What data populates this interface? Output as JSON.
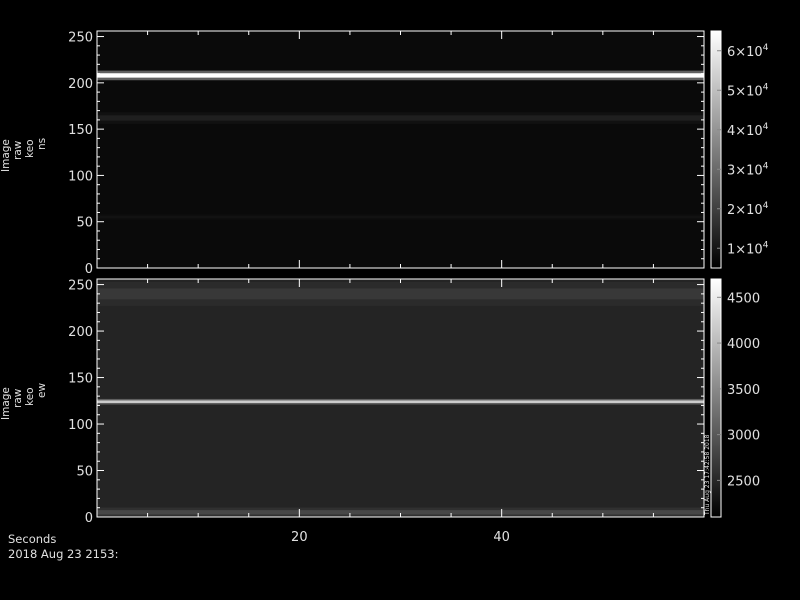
{
  "chart_data": [
    {
      "type": "heatmap",
      "ylabel_lines": [
        "Image",
        "raw",
        "keo",
        "ns"
      ],
      "ylim": [
        0,
        256
      ],
      "yticks": [
        0,
        50,
        100,
        150,
        200,
        250
      ],
      "ytick_labels": [
        "0",
        "50",
        "100",
        "150",
        "200",
        "250"
      ],
      "xlim": [
        0,
        60
      ],
      "colorbar": {
        "range": [
          5000,
          65000
        ],
        "ticks": [
          10000,
          20000,
          30000,
          40000,
          50000,
          60000
        ],
        "tick_labels": [
          {
            "mantissa": "1",
            "exp": "4"
          },
          {
            "mantissa": "2",
            "exp": "4"
          },
          {
            "mantissa": "3",
            "exp": "4"
          },
          {
            "mantissa": "4",
            "exp": "4"
          },
          {
            "mantissa": "5",
            "exp": "4"
          },
          {
            "mantissa": "6",
            "exp": "4"
          }
        ]
      },
      "background_level": 0.04,
      "bands": [
        {
          "y": 208,
          "level": 1.0,
          "width": 3
        },
        {
          "y": 162,
          "level": 0.12,
          "width": 4
        },
        {
          "y": 55,
          "level": 0.07,
          "width": 1
        }
      ]
    },
    {
      "type": "heatmap",
      "ylabel_lines": [
        "Image",
        "raw",
        "keo",
        "ew"
      ],
      "ylim": [
        0,
        256
      ],
      "yticks": [
        0,
        50,
        100,
        150,
        200,
        250
      ],
      "ytick_labels": [
        "0",
        "50",
        "100",
        "150",
        "200",
        "250"
      ],
      "xlim": [
        0,
        60
      ],
      "colorbar": {
        "range": [
          2100,
          4700
        ],
        "ticks": [
          2500,
          3000,
          3500,
          4000,
          4500
        ],
        "tick_labels": [
          "2500",
          "3000",
          "3500",
          "4000",
          "4500"
        ],
        "side_text": "Thu Aug 23 17:42:58 2018"
      },
      "background_level": 0.14,
      "bands": [
        {
          "y": 124,
          "level": 0.8,
          "width": 1
        },
        {
          "y": 240,
          "level": 0.22,
          "width": 10
        },
        {
          "y": 5,
          "level": 0.28,
          "width": 3
        }
      ]
    }
  ],
  "x_axis": {
    "ticks": [
      20,
      40
    ],
    "tick_labels": [
      "20",
      "40"
    ],
    "label": "Seconds",
    "sublabel": "2018 Aug 23 2153:"
  },
  "colors": {
    "background": "#000000",
    "axis": "#ffffff",
    "text": "#e0e0e0"
  }
}
